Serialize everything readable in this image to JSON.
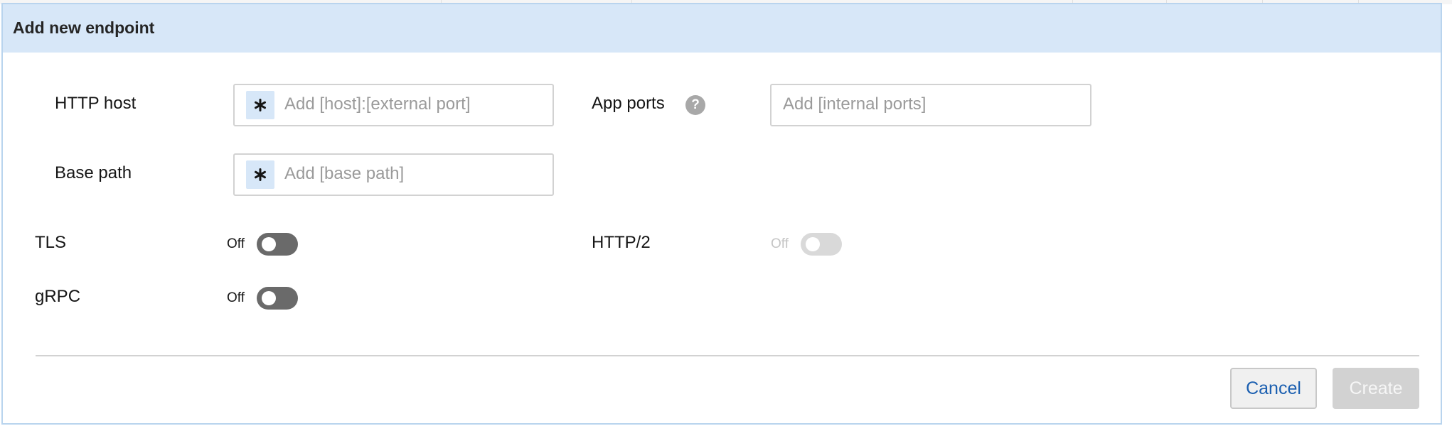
{
  "dialog": {
    "title": "Add new endpoint"
  },
  "form": {
    "http_host": {
      "label": "HTTP host",
      "placeholder": "Add [host]:[external port]",
      "required_icon": "asterisk-icon"
    },
    "app_ports": {
      "label": "App ports",
      "help_icon": "question-circle-icon",
      "help_glyph": "?",
      "placeholder": "Add [internal ports]"
    },
    "base_path": {
      "label": "Base path",
      "placeholder": "Add [base path]",
      "required_icon": "asterisk-icon"
    },
    "tls": {
      "label": "TLS",
      "state": "Off",
      "enabled": true
    },
    "http2": {
      "label": "HTTP/2",
      "state": "Off",
      "enabled": false
    },
    "grpc": {
      "label": "gRPC",
      "state": "Off",
      "enabled": true
    }
  },
  "footer": {
    "cancel_label": "Cancel",
    "create_label": "Create"
  },
  "colors": {
    "header_bg": "#d7e7f8",
    "border": "#b9d4ee",
    "link_blue": "#1b5fb0",
    "toggle_off": "#6a6a6a",
    "disabled": "#d2d2d2"
  }
}
